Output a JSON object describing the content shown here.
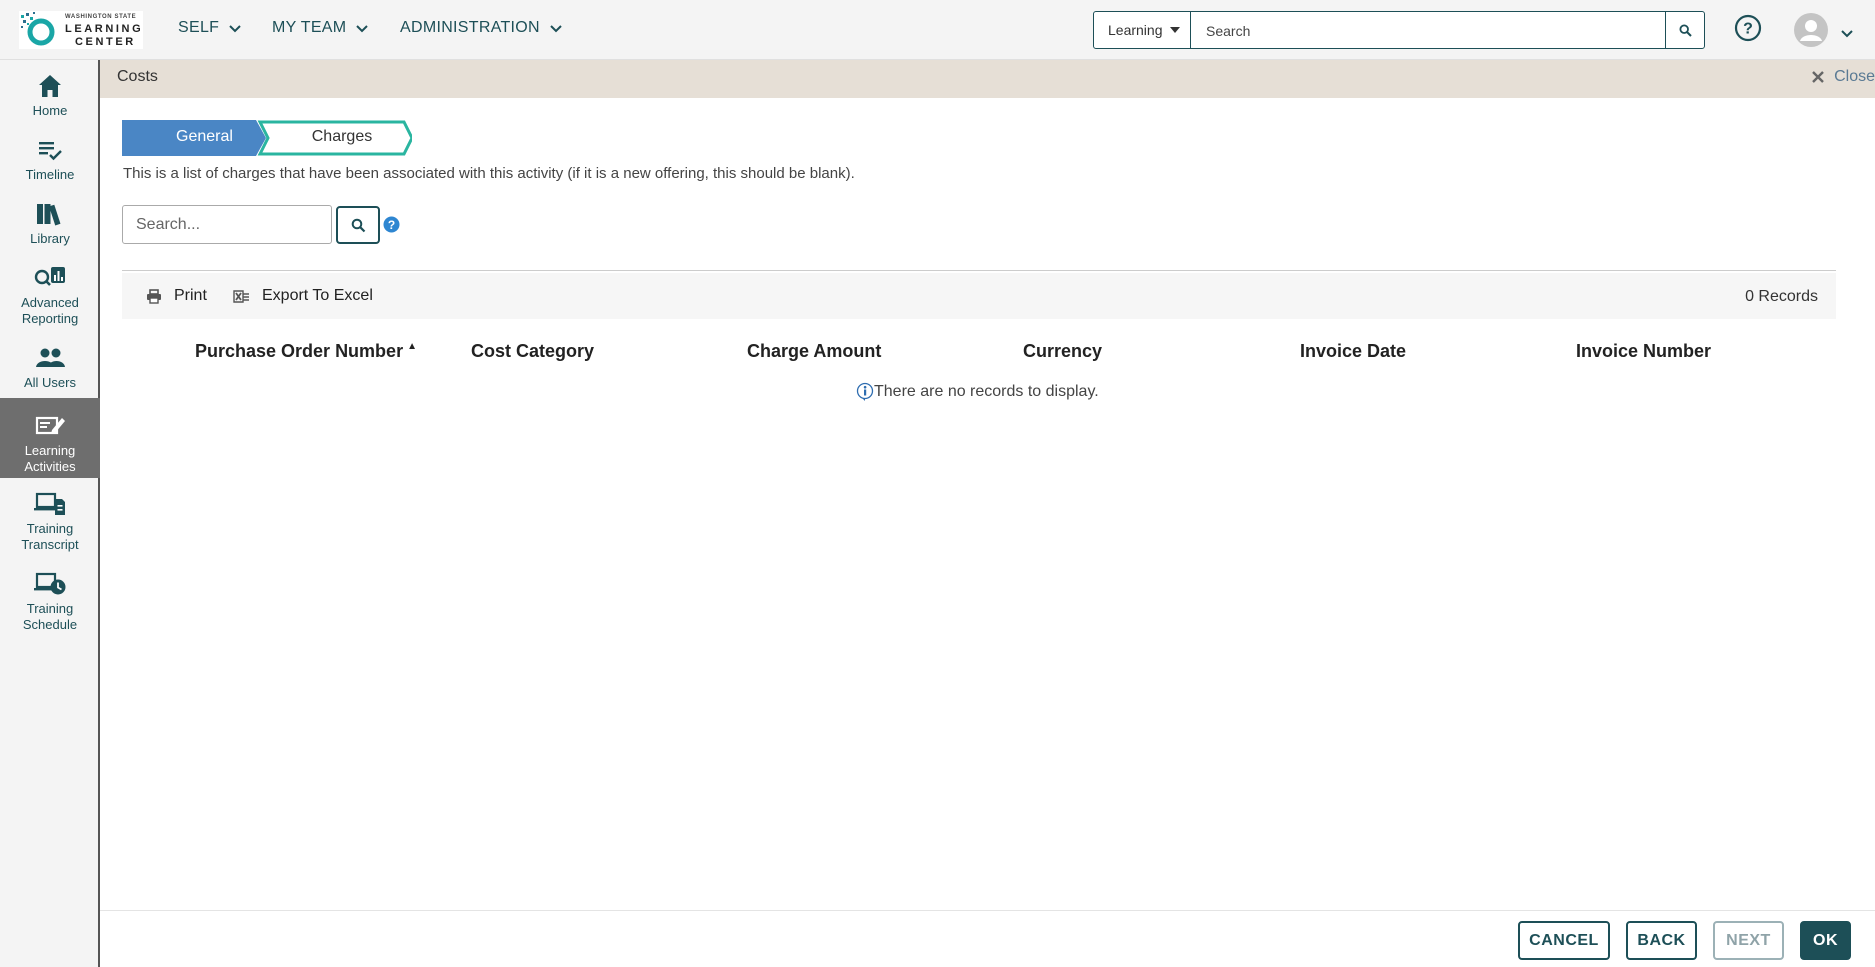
{
  "header": {
    "logo": {
      "small": "WASHINGTON STATE",
      "line1": "LEARNING",
      "line2": "CENTER"
    },
    "nav": [
      {
        "label": "SELF"
      },
      {
        "label": "MY TEAM"
      },
      {
        "label": "ADMINISTRATION"
      }
    ],
    "search": {
      "scope": "Learning",
      "placeholder": "Search"
    }
  },
  "sidebar": {
    "items": [
      {
        "label": "Home",
        "icon": "home-icon"
      },
      {
        "label": "Timeline",
        "icon": "timeline-icon"
      },
      {
        "label": "Library",
        "icon": "library-icon"
      },
      {
        "label": "Advanced Reporting",
        "icon": "reporting-icon"
      },
      {
        "label": "All Users",
        "icon": "users-icon"
      },
      {
        "label": "Learning Activities",
        "icon": "learning-activities-icon",
        "active": true
      },
      {
        "label": "Training Transcript",
        "icon": "transcript-icon"
      },
      {
        "label": "Training Schedule",
        "icon": "schedule-icon"
      }
    ]
  },
  "panel": {
    "title": "Costs",
    "close_label": "Close"
  },
  "wizard": {
    "steps": [
      {
        "label": "General",
        "state": "completed"
      },
      {
        "label": "Charges",
        "state": "current"
      }
    ]
  },
  "content": {
    "description": "This is a list of charges that have been associated with this activity (if it is a new offering, this should be blank).",
    "search_placeholder": "Search...",
    "toolbar": {
      "print": "Print",
      "export": "Export To Excel",
      "records": "0 Records"
    },
    "columns": [
      "Purchase Order Number",
      "Cost Category",
      "Charge Amount",
      "Currency",
      "Invoice Date",
      "Invoice Number"
    ],
    "empty_message": "There are no records to display."
  },
  "footer": {
    "cancel": "CANCEL",
    "back": "BACK",
    "next": "NEXT",
    "ok": "OK"
  },
  "colors": {
    "brand": "#1d4f57",
    "step_completed": "#4a86c5",
    "step_current_border": "#2ab5a0",
    "active_sidebar": "#6e6e6e",
    "band": "#e6dfd6"
  }
}
